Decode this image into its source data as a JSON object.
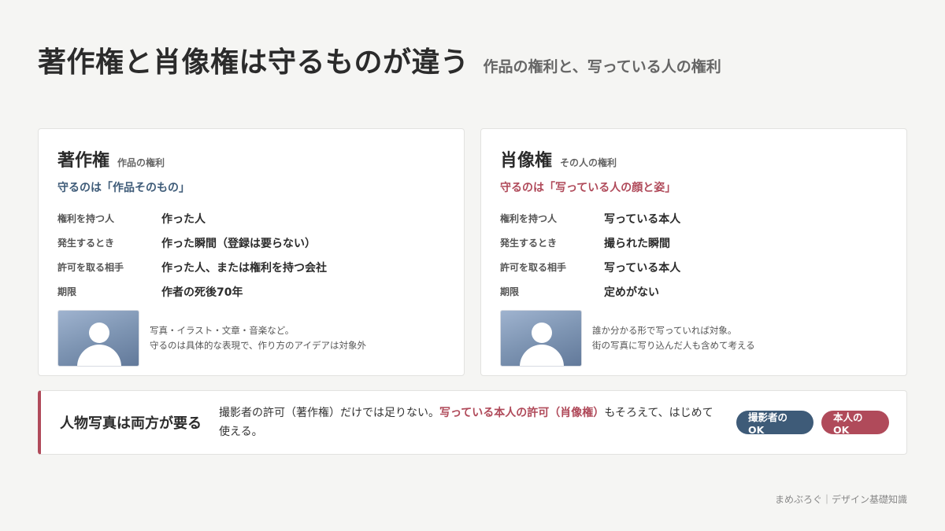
{
  "header": {
    "title": "著作権と肖像権は守るものが違う",
    "subtitle": "作品の権利と、写っている人の権利"
  },
  "cards": [
    {
      "title": "著作権",
      "sub": "作品の権利",
      "lead": "守るのは「作品そのもの」",
      "rows": [
        {
          "label": "権利を持つ人",
          "value": "作った人"
        },
        {
          "label": "発生するとき",
          "value": "作った瞬間（登録は要らない）"
        },
        {
          "label": "許可を取る相手",
          "value": "作った人、または権利を持つ会社"
        },
        {
          "label": "期限",
          "value": "作者の死後70年"
        }
      ],
      "note_line1": "写真・イラスト・文章・音楽など。",
      "note_line2": "守るのは具体的な表現で、作り方のアイデアは対象外"
    },
    {
      "title": "肖像権",
      "sub": "その人の権利",
      "lead": "守るのは「写っている人の顔と姿」",
      "rows": [
        {
          "label": "権利を持つ人",
          "value": "写っている本人"
        },
        {
          "label": "発生するとき",
          "value": "撮られた瞬間"
        },
        {
          "label": "許可を取る相手",
          "value": "写っている本人"
        },
        {
          "label": "期限",
          "value": "定めがない"
        }
      ],
      "note_line1": "誰か分かる形で写っていれば対象。",
      "note_line2": "街の写真に写り込んだ人も含めて考える"
    }
  ],
  "banner": {
    "title": "人物写真は両方が要る",
    "text_before": "撮影者の許可（著作権）だけでは足りない。",
    "text_emphasis": "写っている本人の許可（肖像権）",
    "text_after": "もそろえて、はじめて使える。",
    "badge_photographer": "撮影者のOK",
    "badge_person": "本人のOK"
  },
  "footer": "まめぶろぐ｜デザイン基礎知識",
  "colors": {
    "navy": "#3e5b78",
    "red": "#b04a5a",
    "background": "#f5f5f3"
  },
  "icons": [
    "person-silhouette-icon"
  ]
}
